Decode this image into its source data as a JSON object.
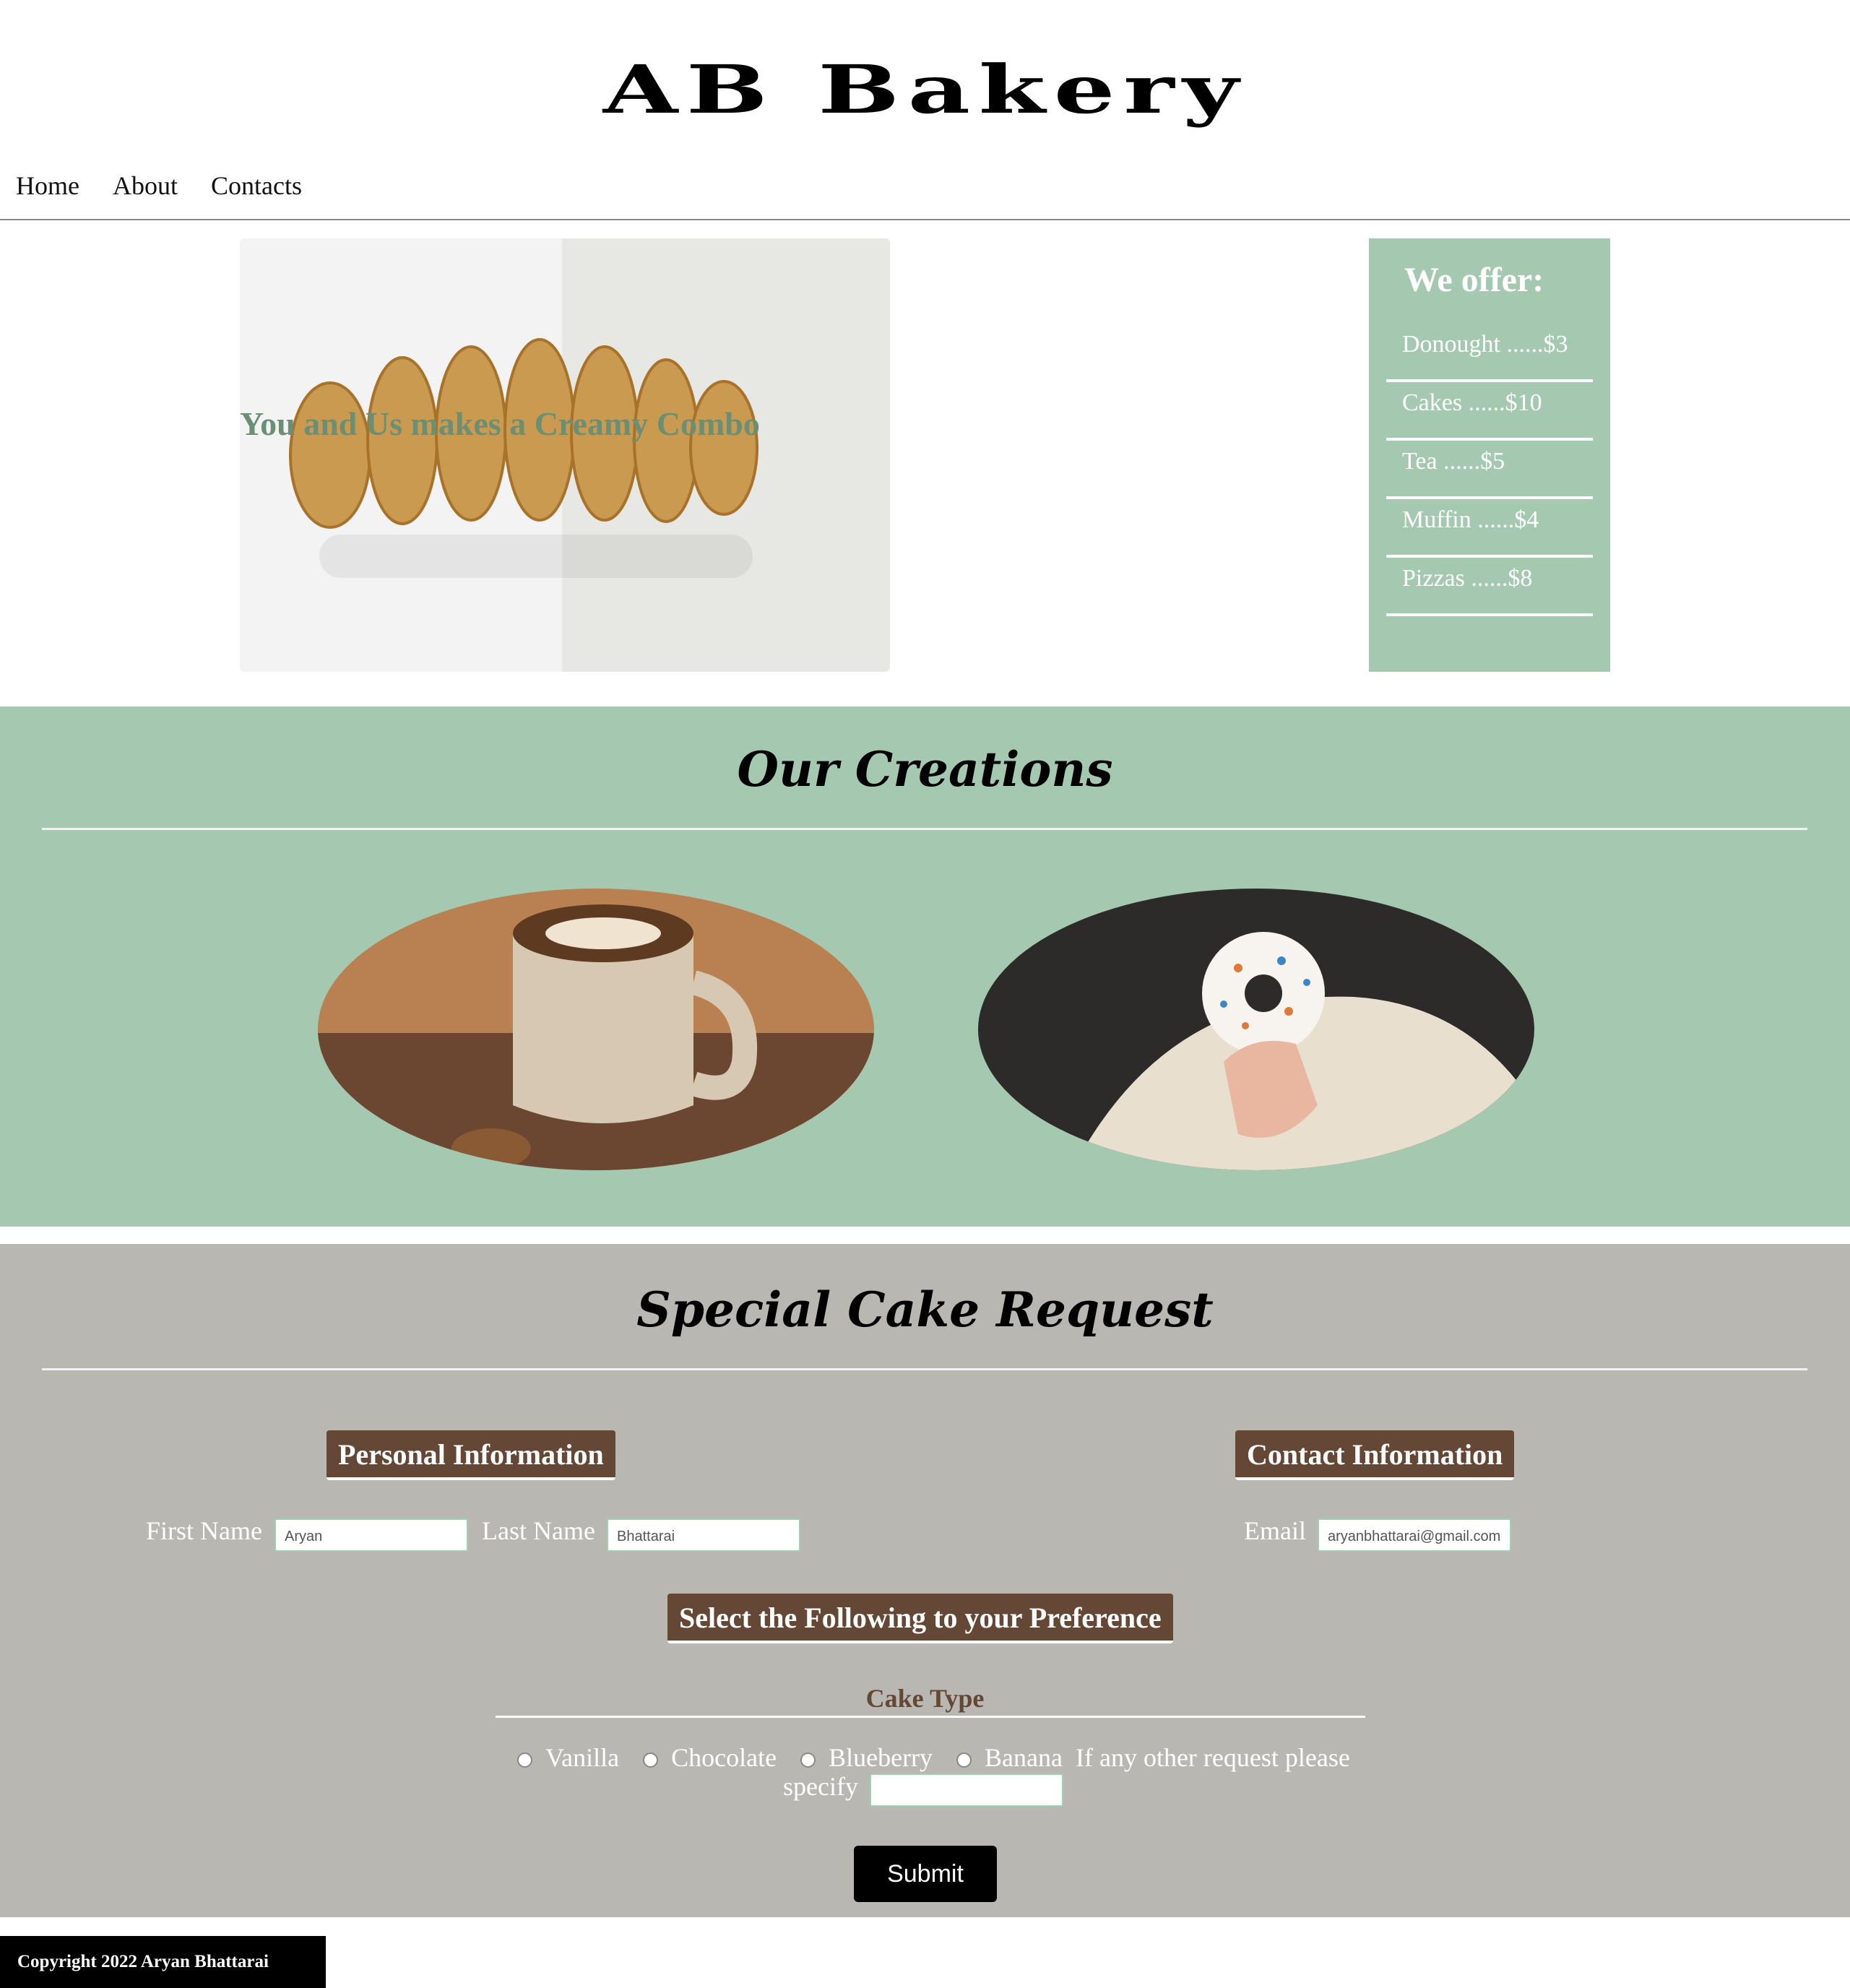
{
  "brand": {
    "title": "AB Bakery"
  },
  "nav": {
    "items": [
      "Home",
      "About",
      "Contacts"
    ]
  },
  "hero": {
    "tagline": "You and Us makes a Creamy Combo"
  },
  "offer": {
    "heading": "We offer:",
    "items": [
      "Donought ......$3",
      "Cakes ......$10",
      "Tea ......$5",
      "Muffin ......$4",
      "Pizzas ......$8"
    ]
  },
  "creations": {
    "title": "Our Creations"
  },
  "request": {
    "title": "Special Cake Request",
    "personal_heading": "Personal Information",
    "contact_heading": "Contact Information",
    "first_name_label": "First Name",
    "first_name_value": "Aryan",
    "last_name_label": "Last Name",
    "last_name_value": "Bhattarai",
    "email_label": "Email",
    "email_value": "aryanbhattarai@gmail.com",
    "preference_heading": "Select the Following to your Preference",
    "cake_type_heading": "Cake Type",
    "options": [
      "Vanilla",
      "Chocolate",
      "Blueberry",
      "Banana"
    ],
    "other_label_line1": "If any other request please",
    "other_label_line2": "specify",
    "other_value": "",
    "submit_label": "Submit"
  },
  "footer": {
    "copyright": "Copyright 2022 Aryan Bhattarai"
  },
  "colors": {
    "mint": "#a5c9b0",
    "stone": "#b8b7b2",
    "brown": "#654736",
    "tagline": "#6a8f74"
  }
}
